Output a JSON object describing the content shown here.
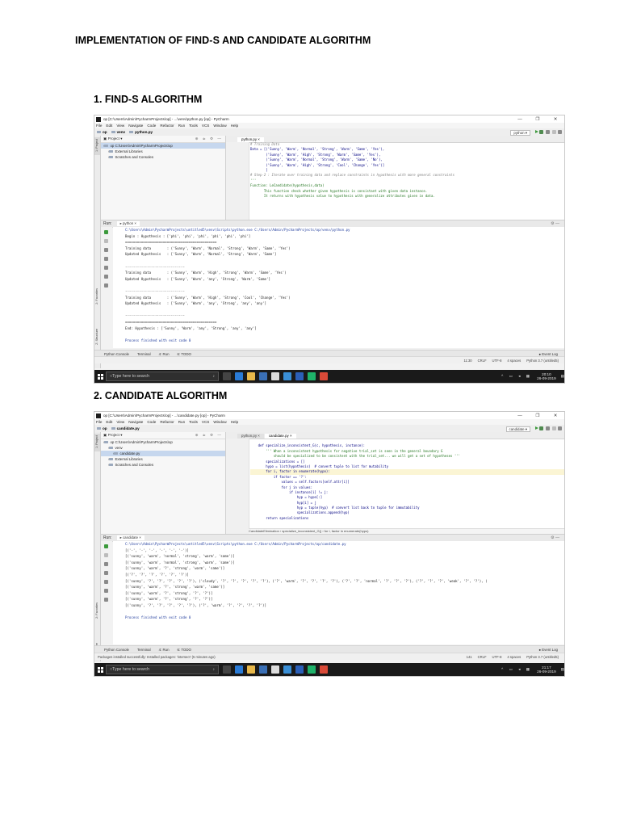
{
  "heading": "IMPLEMENTATION OF FIND-S AND CANDIDATE ALGORITHM",
  "sections": [
    {
      "title": "1.   FIND-S ALGORITHM",
      "window_title": "op [C:\\Users\\Admin\\PycharmProjects\\op] - ...\\venv\\python.py [op] - PyCharm",
      "menu": [
        "File",
        "Edit",
        "View",
        "Navigate",
        "Code",
        "Refactor",
        "Run",
        "Tools",
        "VCS",
        "Window",
        "Help"
      ],
      "breadcrumb": [
        "op",
        "venv",
        "python.py"
      ],
      "run_config": "python",
      "project_panel_title": "Project",
      "project_tree": [
        {
          "label": "op  C:\\Users\\Admin\\PycharmProjects\\op",
          "level": 0,
          "selected": true
        },
        {
          "label": "External Libraries",
          "level": 1,
          "selected": false
        },
        {
          "label": "Scratches and Consoles",
          "level": 1,
          "selected": false
        }
      ],
      "editor_tabs": [
        "python.py"
      ],
      "code_lines": [
        {
          "n": "5",
          "t": "# Training Data",
          "k": "cmt"
        },
        {
          "n": "7",
          "t": "Data = [('Sunny', 'Warm', 'Normal', 'Strong', 'Warm', 'Same', 'Yes'),",
          "k": ""
        },
        {
          "n": "8",
          "t": "        ('Sunny', 'Warm', 'High', 'Strong', 'Warm', 'Same', 'Yes'),",
          "k": ""
        },
        {
          "n": "9",
          "t": "        ('Sunny', 'Warm', 'Normal', 'Strong', 'Warm', 'Same', 'No'),",
          "k": ""
        },
        {
          "n": "10",
          "t": "        ('Sunny', 'Warm', 'High', 'Strong', 'Cool', 'Change', 'Yes')]",
          "k": ""
        },
        {
          "n": "11",
          "t": "        ]",
          "k": ""
        },
        {
          "n": "12",
          "t": "# Step-2 : Iterate over training data and replace constraints in hypothesis with more general constraints",
          "k": "cmt"
        },
        {
          "n": "13",
          "t": "'''",
          "k": "doc"
        },
        {
          "n": "14",
          "t": "Function: LeCandidate(hypothesis,data)",
          "k": "doc"
        },
        {
          "n": "15",
          "t": "       This function check whether given hypothesis is consistant with given data instance.",
          "k": "doc"
        },
        {
          "n": "16",
          "t": "       It returns with hypothesis value to hypothesis with generalize attributes given in data.",
          "k": "doc"
        }
      ],
      "run_label": "Run:",
      "run_tab": "python",
      "console_lines": [
        {
          "t": "C:\\Users\\Admin\\PycharmProjects\\untitled5\\venv\\Scripts\\python.exe C:/Users/Admin/PycharmProjects/op/venv/python.py",
          "k": "path"
        },
        {
          "t": "Begin : Hypothesis : ['phi', 'phi', 'phi', 'phi', 'phi', 'phi']",
          "k": ""
        },
        {
          "t": "==============================================",
          "k": ""
        },
        {
          "t": "Training data        : ('Sunny', 'Warm', 'Normal', 'Strong', 'Warm', 'Same', 'Yes')",
          "k": ""
        },
        {
          "t": "Updated Hypothesis   : ['Sunny', 'Warm', 'Normal', 'Strong', 'Warm', 'Same']",
          "k": ""
        },
        {
          "t": "",
          "k": ""
        },
        {
          "t": "------------------------------",
          "k": ""
        },
        {
          "t": "Training data        : ('Sunny', 'Warm', 'High', 'Strong', 'Warm', 'Same', 'Yes')",
          "k": ""
        },
        {
          "t": "Updated Hypothesis   : ['Sunny', 'Warm', 'any', 'Strong', 'Warm', 'Same']",
          "k": ""
        },
        {
          "t": "",
          "k": ""
        },
        {
          "t": "------------------------------",
          "k": ""
        },
        {
          "t": "Training data        : ('Sunny', 'Warm', 'High', 'Strong', 'Cool', 'Change', 'Yes')",
          "k": ""
        },
        {
          "t": "Updated Hypothesis   : ['Sunny', 'Warm', 'any', 'Strong', 'any', 'any']",
          "k": ""
        },
        {
          "t": "",
          "k": ""
        },
        {
          "t": "------------------------------",
          "k": ""
        },
        {
          "t": "==============================================",
          "k": ""
        },
        {
          "t": "End: Hypothesis : ['Sunny', 'Warm', 'any', 'Strong', 'any', 'any']",
          "k": ""
        },
        {
          "t": "",
          "k": ""
        },
        {
          "t": "Process finished with exit code 0",
          "k": "fin"
        }
      ],
      "bottom_tabs": [
        "Python Console",
        "Terminal",
        "4: Run",
        "6: TODO"
      ],
      "event_log": "Event Log",
      "status_left": "",
      "status_right": [
        "11:30",
        "CRLF",
        "UTF-8",
        "4 spaces",
        "Python 3.7 (untitled5)"
      ],
      "search_placeholder": "Type here to search",
      "clock_time": "20:10",
      "clock_date": "26-09-2019"
    },
    {
      "title": "2.   CANDIDATE ALGORITHM",
      "window_title": "op [C:\\Users\\Admin\\PycharmProjects\\op] - ...\\candidate.py [op] - PyCharm",
      "menu": [
        "File",
        "Edit",
        "View",
        "Navigate",
        "Code",
        "Refactor",
        "Run",
        "Tools",
        "VCS",
        "Window",
        "Help"
      ],
      "breadcrumb": [
        "op",
        "candidate.py"
      ],
      "run_config": "candidate",
      "project_panel_title": "Project",
      "project_tree": [
        {
          "label": "op  C:\\Users\\Admin\\PycharmProjects\\op",
          "level": 0,
          "selected": false
        },
        {
          "label": "venv",
          "level": 1,
          "selected": false
        },
        {
          "label": "candidate.py",
          "level": 2,
          "selected": true
        },
        {
          "label": "External Libraries",
          "level": 1,
          "selected": false
        },
        {
          "label": "Scratches and Consoles",
          "level": 1,
          "selected": false
        }
      ],
      "editor_tabs": [
        "python.py",
        "candidate.py"
      ],
      "code_lines": [
        {
          "n": "277",
          "t": "",
          "k": ""
        },
        {
          "n": "278",
          "t": "    def specialize_inconsistent_G(c, hypothesis, instance):",
          "k": ""
        },
        {
          "n": "279",
          "t": "        ''' When a inconsistent hypothesis for negative trial_set is seen in the general boundary G",
          "k": "doc"
        },
        {
          "n": "280",
          "t": "            should be specialized to be consistent with the trial_set... we will get a set of hypotheses '''",
          "k": "doc"
        },
        {
          "n": "281",
          "t": "        specializations = []",
          "k": ""
        },
        {
          "n": "282",
          "t": "        hypo = list(hypothesis)  # convert tuple to list for mutability",
          "k": ""
        },
        {
          "n": "283",
          "t": "        for i, factor in enumerate(hypo):",
          "k": "hl"
        },
        {
          "n": "284",
          "t": "            if factor == '?':",
          "k": ""
        },
        {
          "n": "285",
          "t": "                values = self.factors[self.attr[i]]",
          "k": ""
        },
        {
          "n": "286",
          "t": "                for j in values:",
          "k": ""
        },
        {
          "n": "287",
          "t": "                    if instance[i] != j:",
          "k": ""
        },
        {
          "n": "288",
          "t": "                        hyp = hypo[:]",
          "k": ""
        },
        {
          "n": "289",
          "t": "                        hyp[i] = j",
          "k": ""
        },
        {
          "n": "290",
          "t": "                        hyp = tuple(hyp)  # convert list back to tuple for immutability",
          "k": ""
        },
        {
          "n": "291",
          "t": "                        specializations.append(hyp)",
          "k": ""
        },
        {
          "n": "292",
          "t": "        return specializations",
          "k": ""
        }
      ],
      "code_breadcrumb": [
        "CandidateElimination",
        "specialize_inconsistent_G()",
        "for i, factor in enumerate(hypo)"
      ],
      "run_label": "Run:",
      "run_tab": "candidate",
      "console_lines": [
        {
          "t": "C:\\Users\\Admin\\PycharmProjects\\untitled5\\venv\\Scripts\\python.exe C:/Users/Admin/PycharmProjects/op/candidate.py",
          "k": "path"
        },
        {
          "t": "[('-', '-', '-', '-', '-', '-')]",
          "k": ""
        },
        {
          "t": "[('sunny', 'warm', 'normal', 'strong', 'warm', 'same')]",
          "k": ""
        },
        {
          "t": "[('sunny', 'warm', 'normal', 'strong', 'warm', 'same')]",
          "k": ""
        },
        {
          "t": "[('sunny', 'warm', '?', 'strong', 'warm', 'same')]",
          "k": ""
        },
        {
          "t": "[('?', '?', '?', '?', '?', '?')]",
          "k": ""
        },
        {
          "t": "[('sunny', '?', '?', '?', '?', '?'), ('cloudy', '?', '?', '?', '?', '?'), ('?', 'warm', '?', '?', '?', '?'), ('?', '?', 'normal', '?', '?', '?'), ('?', '?', '?', 'weak', '?', '?'), (",
          "k": ""
        },
        {
          "t": "[('sunny', 'warm', '?', 'strong', 'warm', 'same')]",
          "k": ""
        },
        {
          "t": "[('sunny', 'warm', '?', 'strong', '?', '?')]",
          "k": ""
        },
        {
          "t": "[('sunny', 'warm', '?', 'strong', '?', '?')]",
          "k": ""
        },
        {
          "t": "[('sunny', '?', '?', '?', '?', '?'), ('?', 'warm', '?', '?', '?', '?')]",
          "k": ""
        },
        {
          "t": "",
          "k": ""
        },
        {
          "t": "Process finished with exit code 0",
          "k": "fin"
        }
      ],
      "bottom_tabs": [
        "Python Console",
        "Terminal",
        "4: Run",
        "6: TODO"
      ],
      "event_log": "Event Log",
      "status_left": "Packages installed successfully: Installed packages: 'intersect' (5 minutes ago)",
      "status_right": [
        "141",
        "CRLF",
        "UTF-8",
        "4 spaces",
        "Python 3.7 (untitled5)"
      ],
      "search_placeholder": "Type here to search",
      "clock_time": "21:17",
      "clock_date": "26-09-2019"
    }
  ],
  "colors": {
    "accent_run": "#3c9a3c",
    "taskbar": "#1a1a1a",
    "selection": "#c6d7ee"
  }
}
